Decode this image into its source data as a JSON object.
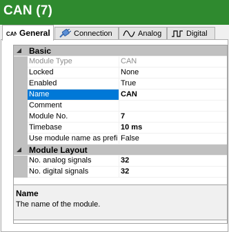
{
  "title_bar": {
    "title": "CAN (7)",
    "background": "#2f8a2f"
  },
  "tabs": [
    {
      "label": "General",
      "icon": "can-bus-icon",
      "icon_text": "CAN",
      "active": true
    },
    {
      "label": "Connection",
      "icon": "connector-plug-icon",
      "active": false
    },
    {
      "label": "Analog",
      "icon": "analog-wave-icon",
      "active": false
    },
    {
      "label": "Digital",
      "icon": "digital-square-wave-icon",
      "active": false
    }
  ],
  "property_grid": {
    "categories": [
      {
        "name": "Basic",
        "expanded": true,
        "properties": [
          {
            "label": "Module Type",
            "value": "CAN",
            "disabled": true
          },
          {
            "label": "Locked",
            "value": "None"
          },
          {
            "label": "Enabled",
            "value": "True"
          },
          {
            "label": "Name",
            "value": "CAN",
            "selected": true,
            "bold": true
          },
          {
            "label": "Comment",
            "value": ""
          },
          {
            "label": "Module No.",
            "value": "7",
            "bold": true
          },
          {
            "label": "Timebase",
            "value": "10 ms",
            "bold": true
          },
          {
            "label": "Use module name as prefi",
            "value": "False"
          }
        ]
      },
      {
        "name": "Module Layout",
        "expanded": true,
        "properties": [
          {
            "label": "No. analog signals",
            "value": "32",
            "bold": true
          },
          {
            "label": "No. digital signals",
            "value": "32",
            "bold": true
          }
        ]
      }
    ]
  },
  "description": {
    "title": "Name",
    "text": "The name of the module."
  },
  "colors": {
    "selection": "#0078d7",
    "category_band": "#c0c0c0",
    "disabled_text": "#8d8d8d"
  }
}
